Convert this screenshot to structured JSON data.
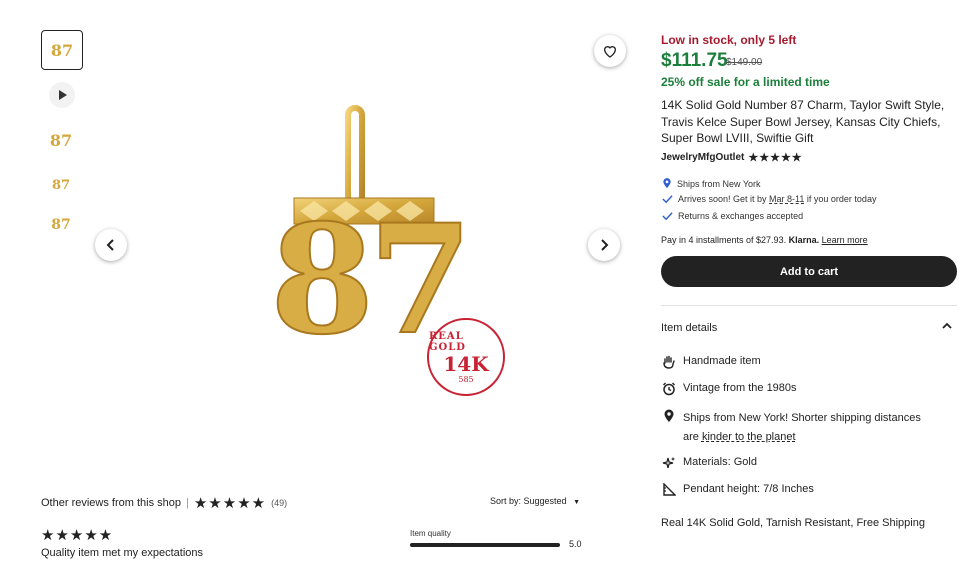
{
  "gallery": {
    "thumbnails": [
      {
        "label": "87",
        "active": true
      },
      {
        "label": "87",
        "active": false
      },
      {
        "label": "87",
        "active": false
      },
      {
        "label": "87",
        "active": false
      }
    ],
    "main_image_number": "87",
    "seal": {
      "top": "REAL GOLD",
      "middle": "14K",
      "bottom": "585"
    }
  },
  "listing": {
    "stock": "Low in stock, only 5 left",
    "price": "$111.75",
    "original_price": "$149.00",
    "sale_text": "25% off sale for a limited time",
    "title": "14K Solid Gold Number 87 Charm, Taylor Swift Style, Travis Kelce Super Bowl Jersey, Kansas City Chiefs, Super Bowl LVIII, Swiftie Gift",
    "shop_name": "JewelryMfgOutlet",
    "shop_stars": "★★★★★",
    "ships_from": "Ships from New York",
    "arrives_prefix": "Arrives soon! Get it by ",
    "arrives_dates": "Mar 8-11",
    "arrives_suffix": " if you order today",
    "returns": "Returns & exchanges accepted",
    "klarna_text": "Pay in 4 installments of $27.93.",
    "klarna_brand": "Klarna.",
    "klarna_link": "Learn more",
    "add_to_cart": "Add to cart"
  },
  "item_details": {
    "heading": "Item details",
    "items": [
      {
        "icon": "hand-icon",
        "text": "Handmade item"
      },
      {
        "icon": "alarm-clock-icon",
        "text": "Vintage from the 1980s"
      },
      {
        "icon": "location-pin-icon",
        "text": "Ships from New York! Shorter shipping distances",
        "text2_prefix": "are ",
        "text2_link": "kinder to the planet"
      },
      {
        "icon": "sparkle-icon",
        "text": "Materials: Gold"
      },
      {
        "icon": "ruler-icon",
        "text": "Pendant height: 7/8 Inches"
      }
    ],
    "description": "Real 14K Solid Gold, Tarnish Resistant, Free Shipping"
  },
  "reviews": {
    "heading": "Other reviews from this shop",
    "stars": "★★★★★",
    "count": "(49)",
    "sort_label": "Sort by: Suggested",
    "first_review": {
      "stars": "★★★★★",
      "text": "Quality item met my expectations",
      "item_quality_label": "Item quality",
      "item_quality_value": "5.0"
    }
  },
  "colors": {
    "stock_red": "#a61a2e",
    "price_green": "#1b7f3b",
    "gold": "#d4a73c"
  }
}
